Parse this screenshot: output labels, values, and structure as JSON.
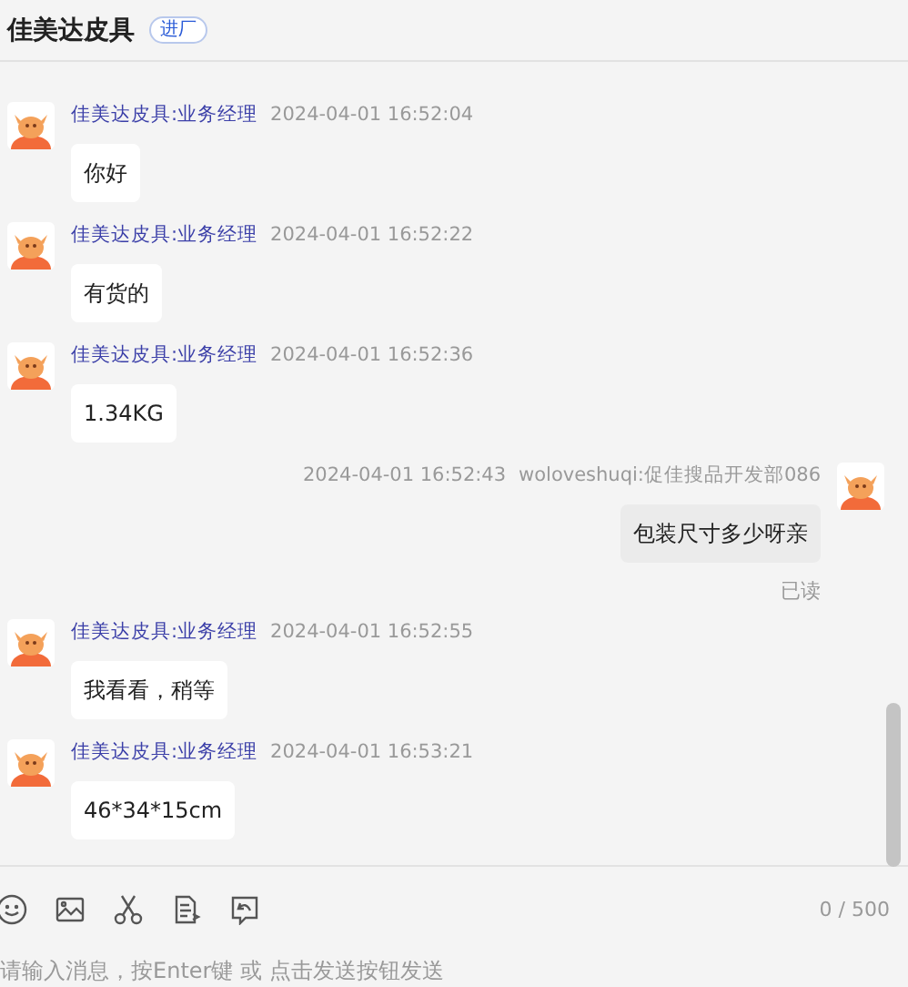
{
  "header": {
    "title": "佳美达皮具",
    "badge": "进厂"
  },
  "messages": [
    {
      "kind": "incoming",
      "sender": "佳美达皮具:业务经理",
      "time": "2024-04-01 16:52:04",
      "text": "你好"
    },
    {
      "kind": "incoming",
      "sender": "佳美达皮具:业务经理",
      "time": "2024-04-01 16:52:22",
      "text": "有货的"
    },
    {
      "kind": "incoming",
      "sender": "佳美达皮具:业务经理",
      "time": "2024-04-01 16:52:36",
      "text": "1.34KG"
    },
    {
      "kind": "outgoing",
      "sender": "woloveshuqi:促佳搜品开发部086",
      "time": "2024-04-01 16:52:43",
      "text": "包装尺寸多少呀亲",
      "status": "已读"
    },
    {
      "kind": "incoming",
      "sender": "佳美达皮具:业务经理",
      "time": "2024-04-01 16:52:55",
      "text": "我看看，稍等"
    },
    {
      "kind": "incoming",
      "sender": "佳美达皮具:业务经理",
      "time": "2024-04-01 16:53:21",
      "text": "46*34*15cm"
    }
  ],
  "composer": {
    "counter": "0 / 500",
    "placeholder": "请输入消息，按Enter键 或 点击发送按钮发送"
  }
}
